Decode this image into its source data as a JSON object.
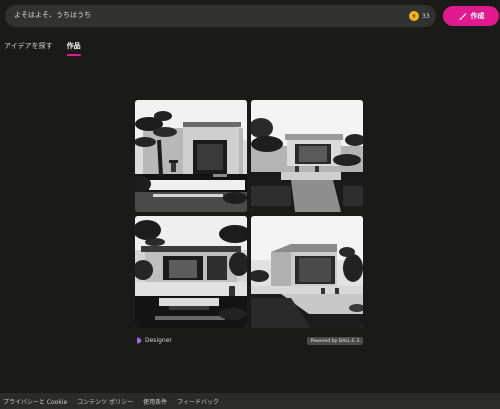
{
  "prompt": {
    "text": "よそはよそ、うちはうち"
  },
  "boosts": {
    "count": "33"
  },
  "create_button": {
    "label": "作成"
  },
  "tabs": [
    {
      "label": "アイデアを探す",
      "active": false
    },
    {
      "label": "作品",
      "active": true
    }
  ],
  "results": {
    "images": [
      {
        "description": "monochrome minimalist Japanese house with bonsai pine and stone lantern"
      },
      {
        "description": "monochrome modern pavilion with reflecting pool and garden"
      },
      {
        "description": "monochrome courtyard house with bonsai trees and pond"
      },
      {
        "description": "monochrome flat-roof house with reflecting pool and bonsai"
      }
    ]
  },
  "brand": {
    "name": "Designer"
  },
  "powered_by": {
    "label": "Powered by DALL·E 3"
  },
  "footer": {
    "links": [
      "プライバシーと Cookie",
      "コンテンツ ポリシー",
      "使用条件",
      "フィードバック"
    ]
  },
  "colors": {
    "accent": "#e01a8e",
    "background": "#1a1a19",
    "coin": "#f3b61a"
  }
}
